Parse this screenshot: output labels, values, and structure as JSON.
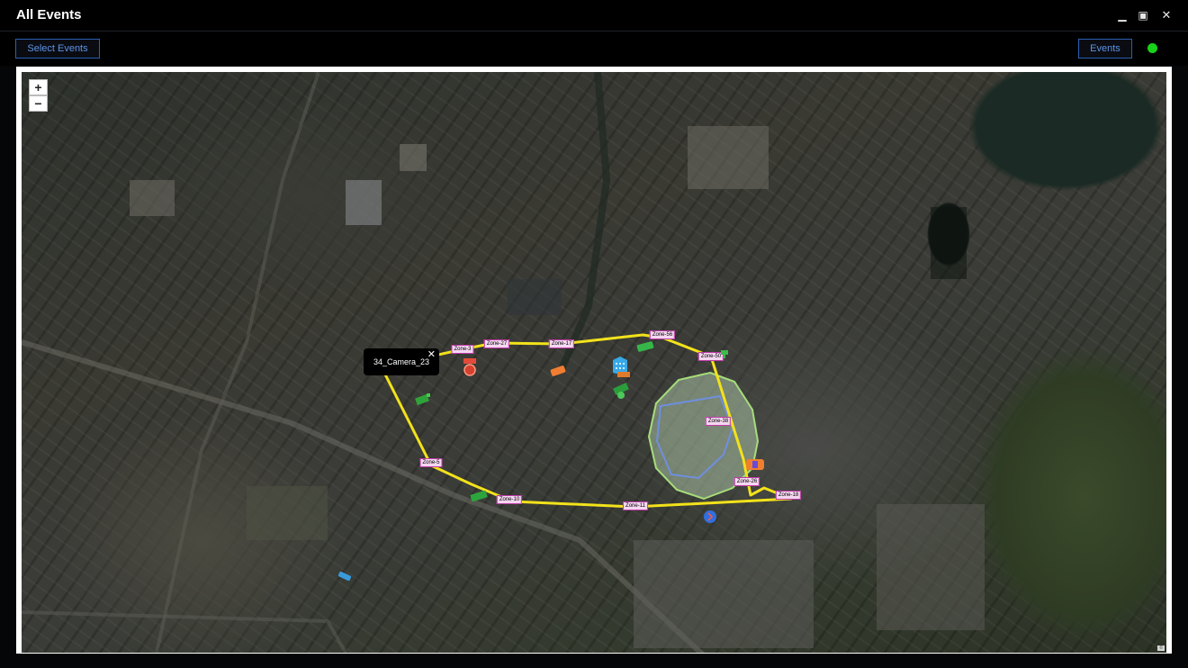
{
  "window": {
    "title": "All Events",
    "controls": {
      "minimize": "▁",
      "restore": "▣",
      "close": "✕"
    }
  },
  "toolbar": {
    "select_events_label": "Select Events",
    "events_label": "Events",
    "status_color": "#19d219"
  },
  "map": {
    "zoom_in": "+",
    "zoom_out": "−",
    "popup": {
      "camera_name": "34_Camera_23",
      "close": "✕"
    },
    "zone_labels": [
      "Zone-3",
      "Zone-27",
      "Zone-17",
      "Zone-56",
      "Zone-50",
      "Zone-38",
      "Zone-26",
      "Zone-18",
      "Zone-11",
      "Zone-10",
      "Zone-5"
    ],
    "route_color": "#f2e21b",
    "geofence_color": "#9fd86a",
    "attribution": "©"
  }
}
